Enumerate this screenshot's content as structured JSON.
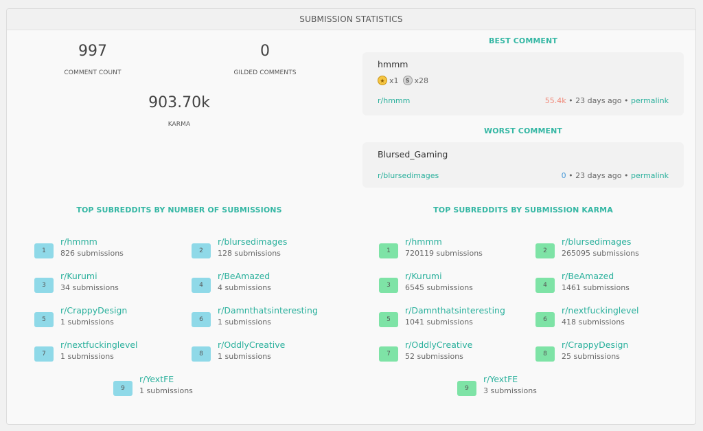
{
  "header": {
    "title": "SUBMISSION STATISTICS"
  },
  "stats": {
    "comment_count": {
      "value": "997",
      "label": "COMMENT COUNT"
    },
    "gilded_comments": {
      "value": "0",
      "label": "GILDED COMMENTS"
    },
    "karma": {
      "value": "903.70k",
      "label": "KARMA"
    }
  },
  "best_comment": {
    "section_title": "BEST COMMENT",
    "title": "hmmm",
    "awards": [
      {
        "icon": "gold-award-icon",
        "count": "x1"
      },
      {
        "icon": "silver-award-icon",
        "count": "x28"
      }
    ],
    "subreddit": "r/hmmm",
    "score": "55.4k",
    "sep1": " • ",
    "age": "23 days ago",
    "sep2": " • ",
    "permalink": "permalink"
  },
  "worst_comment": {
    "section_title": "WORST COMMENT",
    "title": "Blursed_Gaming",
    "subreddit": "r/blursedimages",
    "score": "0",
    "sep1": " • ",
    "age": "23 days ago",
    "sep2": " • ",
    "permalink": "permalink"
  },
  "top_by_count": {
    "title": "TOP SUBREDDITS BY NUMBER OF SUBMISSIONS",
    "badge_color": "#8fd9e8",
    "items": [
      {
        "rank": "1",
        "name": "r/hmmm",
        "count": "826 submissions"
      },
      {
        "rank": "2",
        "name": "r/blursedimages",
        "count": "128 submissions"
      },
      {
        "rank": "3",
        "name": "r/Kurumi",
        "count": "34 submissions"
      },
      {
        "rank": "4",
        "name": "r/BeAmazed",
        "count": "4 submissions"
      },
      {
        "rank": "5",
        "name": "r/CrappyDesign",
        "count": "1 submissions"
      },
      {
        "rank": "6",
        "name": "r/Damnthatsinteresting",
        "count": "1 submissions"
      },
      {
        "rank": "7",
        "name": "r/nextfuckinglevel",
        "count": "1 submissions"
      },
      {
        "rank": "8",
        "name": "r/OddlyCreative",
        "count": "1 submissions"
      },
      {
        "rank": "9",
        "name": "r/YextFE",
        "count": "1 submissions"
      }
    ]
  },
  "top_by_karma": {
    "title": "TOP SUBREDDITS BY SUBMISSION KARMA",
    "badge_color": "#7ee3a6",
    "items": [
      {
        "rank": "1",
        "name": "r/hmmm",
        "count": "720119 submissions"
      },
      {
        "rank": "2",
        "name": "r/blursedimages",
        "count": "265095 submissions"
      },
      {
        "rank": "3",
        "name": "r/Kurumi",
        "count": "6545 submissions"
      },
      {
        "rank": "4",
        "name": "r/BeAmazed",
        "count": "1461 submissions"
      },
      {
        "rank": "5",
        "name": "r/Damnthatsinteresting",
        "count": "1041 submissions"
      },
      {
        "rank": "6",
        "name": "r/nextfuckinglevel",
        "count": "418 submissions"
      },
      {
        "rank": "7",
        "name": "r/OddlyCreative",
        "count": "52 submissions"
      },
      {
        "rank": "8",
        "name": "r/CrappyDesign",
        "count": "25 submissions"
      },
      {
        "rank": "9",
        "name": "r/YextFE",
        "count": "3 submissions"
      }
    ]
  }
}
